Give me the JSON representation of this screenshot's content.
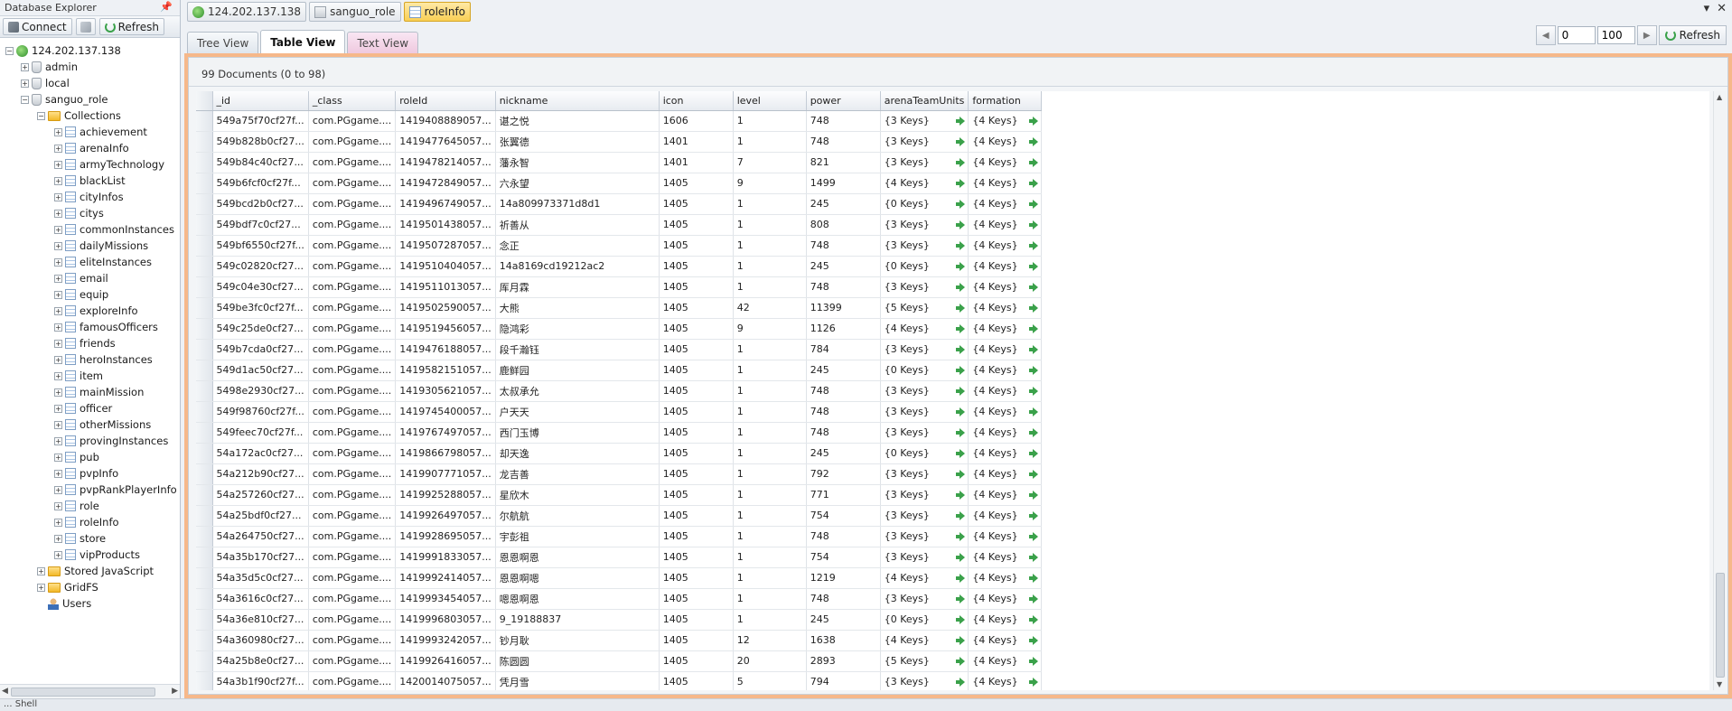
{
  "explorer": {
    "title": "Database Explorer",
    "connect_label": "Connect",
    "refresh_label": "Refresh",
    "server": "124.202.137.138",
    "databases": [
      "admin",
      "local"
    ],
    "active_db": "sanguo_role",
    "collections_label": "Collections",
    "collections": [
      "achievement",
      "arenaInfo",
      "armyTechnology",
      "blackList",
      "cityInfos",
      "citys",
      "commonInstances",
      "dailyMissions",
      "eliteInstances",
      "email",
      "equip",
      "exploreInfo",
      "famousOfficers",
      "friends",
      "heroInstances",
      "item",
      "mainMission",
      "officer",
      "otherMissions",
      "provingInstances",
      "pub",
      "pvpInfo",
      "pvpRankPlayerInfo",
      "role",
      "roleInfo",
      "store",
      "vipProducts"
    ],
    "stored_js_label": "Stored JavaScript",
    "gridfs_label": "GridFS",
    "users_label": "Users"
  },
  "tabs": [
    {
      "label": "124.202.137.138",
      "icon": "globe-icon"
    },
    {
      "label": "sanguo_role",
      "icon": "database-icon"
    },
    {
      "label": "roleInfo",
      "icon": "collection-icon"
    }
  ],
  "views": {
    "tree": "Tree View",
    "table": "Table View",
    "text": "Text View"
  },
  "paging": {
    "skip": "0",
    "limit": "100",
    "refresh_label": "Refresh"
  },
  "doc_count": "99 Documents (0 to 98)",
  "columns": [
    "_id",
    "_class",
    "roleId",
    "nickname",
    "icon",
    "level",
    "power",
    "arenaTeamUnits",
    "formation"
  ],
  "rows": [
    [
      "549a75f70cf27f...",
      "com.PGgame....",
      "1419408889057...",
      "谌之悦",
      "1606",
      "1",
      "748",
      "{3 Keys}",
      "{4 Keys}"
    ],
    [
      "549b828b0cf27...",
      "com.PGgame....",
      "1419477645057...",
      "张翼德",
      "1401",
      "1",
      "748",
      "{3 Keys}",
      "{4 Keys}"
    ],
    [
      "549b84c40cf27...",
      "com.PGgame....",
      "1419478214057...",
      "藩永智",
      "1401",
      "7",
      "821",
      "{3 Keys}",
      "{4 Keys}"
    ],
    [
      "549b6fcf0cf27f...",
      "com.PGgame....",
      "1419472849057...",
      "六永望",
      "1405",
      "9",
      "1499",
      "{4 Keys}",
      "{4 Keys}"
    ],
    [
      "549bcd2b0cf27...",
      "com.PGgame....",
      "1419496749057...",
      "14a809973371d8d1",
      "1405",
      "1",
      "245",
      "{0 Keys}",
      "{4 Keys}"
    ],
    [
      "549bdf7c0cf27...",
      "com.PGgame....",
      "1419501438057...",
      "祈善从",
      "1405",
      "1",
      "808",
      "{3 Keys}",
      "{4 Keys}"
    ],
    [
      "549bf6550cf27f...",
      "com.PGgame....",
      "1419507287057...",
      "念正",
      "1405",
      "1",
      "748",
      "{3 Keys}",
      "{4 Keys}"
    ],
    [
      "549c02820cf27...",
      "com.PGgame....",
      "1419510404057...",
      "14a8169cd19212ac2",
      "1405",
      "1",
      "245",
      "{0 Keys}",
      "{4 Keys}"
    ],
    [
      "549c04e30cf27...",
      "com.PGgame....",
      "1419511013057...",
      "厍月霖",
      "1405",
      "1",
      "748",
      "{3 Keys}",
      "{4 Keys}"
    ],
    [
      "549be3fc0cf27f...",
      "com.PGgame....",
      "1419502590057...",
      "大熊",
      "1405",
      "42",
      "11399",
      "{5 Keys}",
      "{4 Keys}"
    ],
    [
      "549c25de0cf27...",
      "com.PGgame....",
      "1419519456057...",
      "隐鸿彩",
      "1405",
      "9",
      "1126",
      "{4 Keys}",
      "{4 Keys}"
    ],
    [
      "549b7cda0cf27...",
      "com.PGgame....",
      "1419476188057...",
      "段千瀚钰",
      "1405",
      "1",
      "784",
      "{3 Keys}",
      "{4 Keys}"
    ],
    [
      "549d1ac50cf27...",
      "com.PGgame....",
      "1419582151057...",
      "鹿鲜园",
      "1405",
      "1",
      "245",
      "{0 Keys}",
      "{4 Keys}"
    ],
    [
      "5498e2930cf27...",
      "com.PGgame....",
      "1419305621057...",
      "太叔承允",
      "1405",
      "1",
      "748",
      "{3 Keys}",
      "{4 Keys}"
    ],
    [
      "549f98760cf27f...",
      "com.PGgame....",
      "1419745400057...",
      "户天天",
      "1405",
      "1",
      "748",
      "{3 Keys}",
      "{4 Keys}"
    ],
    [
      "549feec70cf27f...",
      "com.PGgame....",
      "1419767497057...",
      "西门玉博",
      "1405",
      "1",
      "748",
      "{3 Keys}",
      "{4 Keys}"
    ],
    [
      "54a172ac0cf27...",
      "com.PGgame....",
      "1419866798057...",
      "却天逸",
      "1405",
      "1",
      "245",
      "{0 Keys}",
      "{4 Keys}"
    ],
    [
      "54a212b90cf27...",
      "com.PGgame....",
      "1419907771057...",
      "龙吉善",
      "1405",
      "1",
      "792",
      "{3 Keys}",
      "{4 Keys}"
    ],
    [
      "54a257260cf27...",
      "com.PGgame....",
      "1419925288057...",
      "星欣木",
      "1405",
      "1",
      "771",
      "{3 Keys}",
      "{4 Keys}"
    ],
    [
      "54a25bdf0cf27...",
      "com.PGgame....",
      "1419926497057...",
      "尔航航",
      "1405",
      "1",
      "754",
      "{3 Keys}",
      "{4 Keys}"
    ],
    [
      "54a264750cf27...",
      "com.PGgame....",
      "1419928695057...",
      "宇彭祖",
      "1405",
      "1",
      "748",
      "{3 Keys}",
      "{4 Keys}"
    ],
    [
      "54a35b170cf27...",
      "com.PGgame....",
      "1419991833057...",
      "恩恩啊恩",
      "1405",
      "1",
      "754",
      "{3 Keys}",
      "{4 Keys}"
    ],
    [
      "54a35d5c0cf27...",
      "com.PGgame....",
      "1419992414057...",
      "恩恩啊嗯",
      "1405",
      "1",
      "1219",
      "{4 Keys}",
      "{4 Keys}"
    ],
    [
      "54a3616c0cf27...",
      "com.PGgame....",
      "1419993454057...",
      "嗯恩啊恩",
      "1405",
      "1",
      "748",
      "{3 Keys}",
      "{4 Keys}"
    ],
    [
      "54a36e810cf27...",
      "com.PGgame....",
      "1419996803057...",
      "9_19188837",
      "1405",
      "1",
      "245",
      "{0 Keys}",
      "{4 Keys}"
    ],
    [
      "54a360980cf27...",
      "com.PGgame....",
      "1419993242057...",
      "钞月耿",
      "1405",
      "12",
      "1638",
      "{4 Keys}",
      "{4 Keys}"
    ],
    [
      "54a25b8e0cf27...",
      "com.PGgame....",
      "1419926416057...",
      "陈圆圆",
      "1405",
      "20",
      "2893",
      "{5 Keys}",
      "{4 Keys}"
    ],
    [
      "54a3b1f90cf27f...",
      "com.PGgame....",
      "1420014075057...",
      "凭月雪",
      "1405",
      "5",
      "794",
      "{3 Keys}",
      "{4 Keys}"
    ]
  ],
  "status_text": "... Shell"
}
